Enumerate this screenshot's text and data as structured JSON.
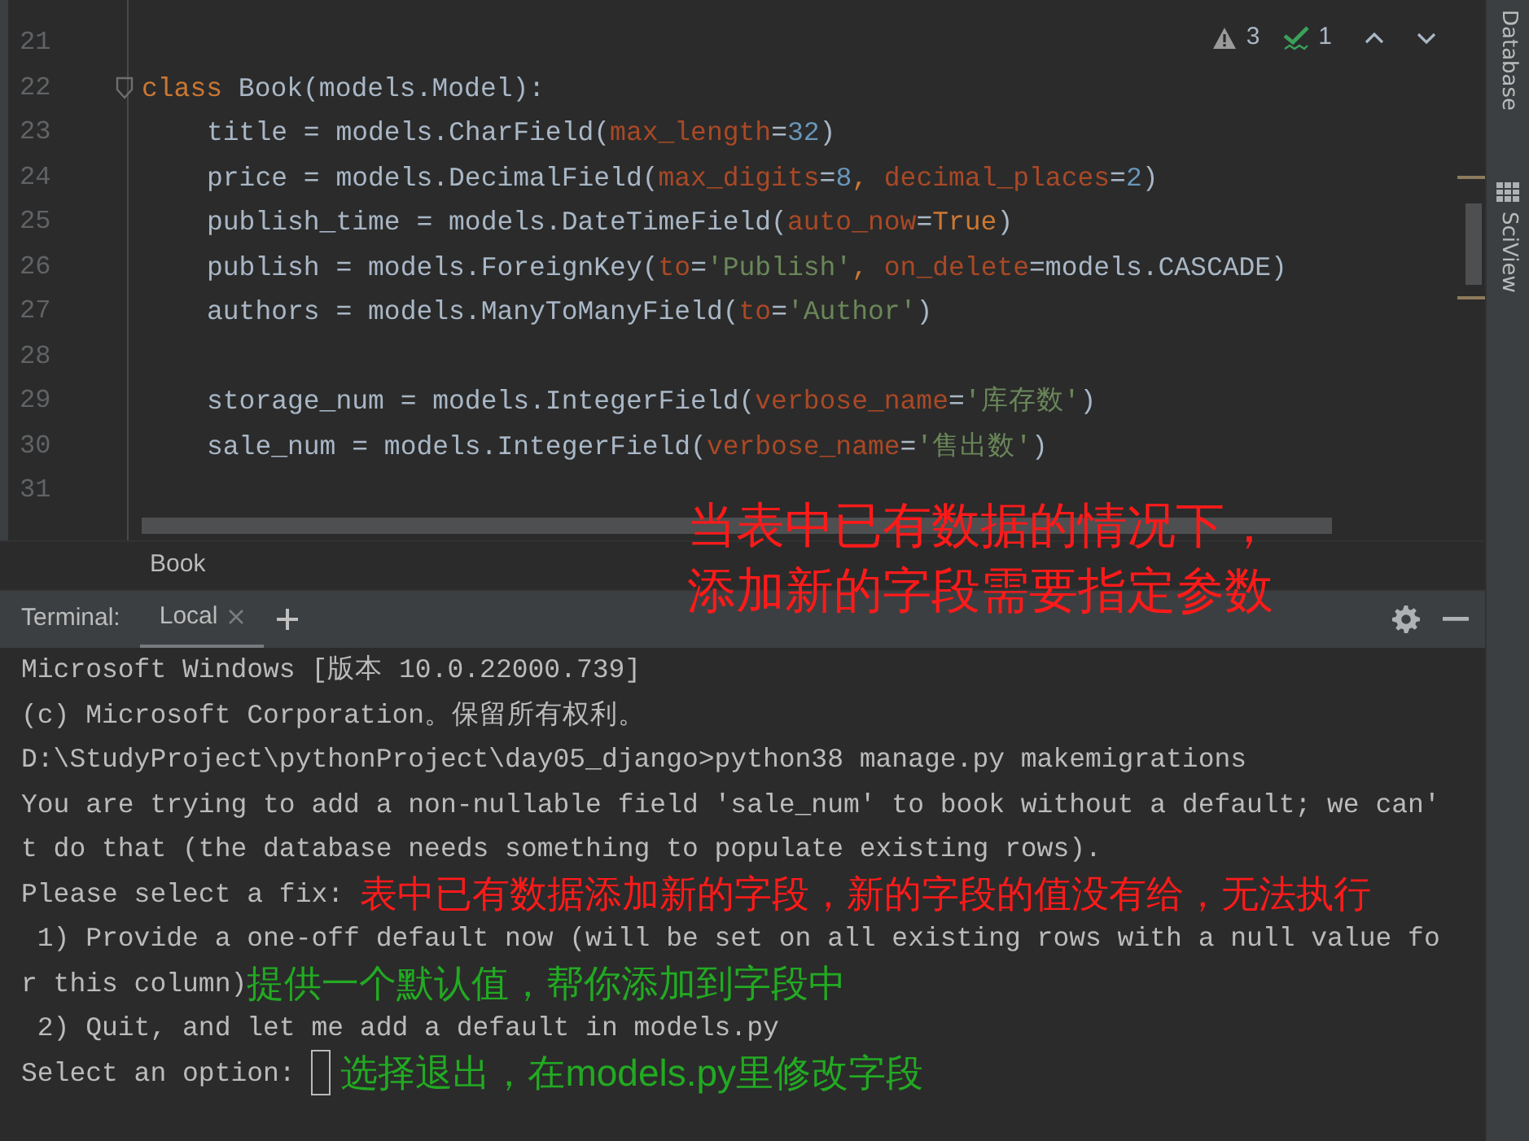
{
  "editor": {
    "inspections": {
      "warning_count": "3",
      "check_count": "1"
    },
    "lines": [
      {
        "number": "21"
      },
      {
        "number": "22",
        "foldable": true,
        "tokens": [
          {
            "kind": "keyword",
            "text": "class"
          },
          {
            "kind": "plain",
            "text": " Book(models.Model):"
          }
        ],
        "children": [
          {
            "number": "23",
            "tokens": [
              {
                "kind": "plain",
                "text": "title = models.CharField("
              },
              {
                "kind": "param",
                "text": "max_length"
              },
              {
                "kind": "plain",
                "text": "="
              },
              {
                "kind": "number",
                "text": "32"
              },
              {
                "kind": "plain",
                "text": ")"
              }
            ]
          },
          {
            "number": "24",
            "tokens": [
              {
                "kind": "plain",
                "text": "price = models.DecimalField("
              },
              {
                "kind": "param",
                "text": "max_digits"
              },
              {
                "kind": "plain",
                "text": "="
              },
              {
                "kind": "number",
                "text": "8"
              },
              {
                "kind": "keyword",
                "text": ", "
              },
              {
                "kind": "param",
                "text": "decimal_places"
              },
              {
                "kind": "plain",
                "text": "="
              },
              {
                "kind": "number",
                "text": "2"
              },
              {
                "kind": "plain",
                "text": ")"
              }
            ]
          },
          {
            "number": "25",
            "tokens": [
              {
                "kind": "plain",
                "text": "publish_time = models.DateTimeField("
              },
              {
                "kind": "param",
                "text": "auto_now"
              },
              {
                "kind": "plain",
                "text": "="
              },
              {
                "kind": "keyword",
                "text": "True"
              },
              {
                "kind": "plain",
                "text": ")"
              }
            ]
          },
          {
            "number": "26",
            "tokens": [
              {
                "kind": "plain",
                "text": "publish = models.ForeignKey("
              },
              {
                "kind": "param",
                "text": "to"
              },
              {
                "kind": "plain",
                "text": "="
              },
              {
                "kind": "string",
                "text": "'Publish'"
              },
              {
                "kind": "keyword",
                "text": ", "
              },
              {
                "kind": "param",
                "text": "on_delete"
              },
              {
                "kind": "plain",
                "text": "=models.CASCADE)"
              }
            ]
          },
          {
            "number": "27",
            "tokens": [
              {
                "kind": "plain",
                "text": "authors = models.ManyToManyField("
              },
              {
                "kind": "param",
                "text": "to"
              },
              {
                "kind": "plain",
                "text": "="
              },
              {
                "kind": "string",
                "text": "'Author'"
              },
              {
                "kind": "plain",
                "text": ")"
              }
            ]
          },
          {
            "number": "28"
          },
          {
            "number": "29",
            "tokens": [
              {
                "kind": "plain",
                "text": "storage_num = models.IntegerField("
              },
              {
                "kind": "param",
                "text": "verbose_name"
              },
              {
                "kind": "plain",
                "text": "="
              },
              {
                "kind": "string",
                "text": "'库存数'"
              },
              {
                "kind": "plain",
                "text": ")"
              }
            ]
          },
          {
            "number": "30",
            "tokens": [
              {
                "kind": "plain",
                "text": "sale_num = models.IntegerField("
              },
              {
                "kind": "param",
                "text": "verbose_name"
              },
              {
                "kind": "plain",
                "text": "="
              },
              {
                "kind": "string",
                "text": "'售出数'"
              },
              {
                "kind": "plain",
                "text": ")"
              }
            ]
          },
          {
            "number": "31"
          }
        ]
      }
    ]
  },
  "breadcrumb": "Book",
  "tool_strip": [
    {
      "kind": "text",
      "label": "Database"
    },
    {
      "kind": "icon-text",
      "label": "SciView"
    }
  ],
  "overlay_note": {
    "color": "#ff1a1a",
    "lines": [
      "当表中已有数据的情况下，",
      "添加新的字段需要指定参数"
    ]
  },
  "terminal": {
    "title": "Terminal:",
    "tabs": [
      {
        "label": "Local",
        "selected": true
      }
    ],
    "lines": [
      {
        "segments": [
          {
            "kind": "output",
            "text": "Microsoft Windows [版本 10.0.22000.739]"
          }
        ]
      },
      {
        "segments": [
          {
            "kind": "output",
            "text": "(c) Microsoft Corporation。保留所有权利。"
          }
        ]
      },
      {
        "segments": [
          {
            "kind": "output",
            "text": "D:\\StudyProject\\pythonProject\\day05_django>python38 manage.py makemigrations"
          }
        ]
      },
      {
        "segments": [
          {
            "kind": "output",
            "text": "You are trying to add a non-nullable field 'sale_num' to book without a default; we can'"
          }
        ]
      },
      {
        "segments": [
          {
            "kind": "output",
            "text": "t do that (the database needs something to populate existing rows)."
          }
        ]
      },
      {
        "segments": [
          {
            "kind": "output",
            "text": "Please select a fix: "
          },
          {
            "kind": "note",
            "color": "#ff1a1a",
            "text": "表中已有数据添加新的字段，新的字段的值没有给，无法执行"
          }
        ]
      },
      {
        "segments": [
          {
            "kind": "output",
            "text": " 1) Provide a one-off default now (will be set on all existing rows with a null value fo"
          }
        ]
      },
      {
        "segments": [
          {
            "kind": "output",
            "text": "r this column)"
          },
          {
            "kind": "note",
            "color": "#22aa22",
            "text": "提供一个默认值，帮你添加到字段中"
          }
        ]
      },
      {
        "segments": [
          {
            "kind": "output",
            "text": " 2) Quit, and let me add a default in models.py"
          }
        ]
      },
      {
        "segments": [
          {
            "kind": "output",
            "text": "Select an option: "
          },
          {
            "kind": "cursor"
          },
          {
            "kind": "note",
            "color": "#22aa22",
            "text": "选择退出，在models.py里修改字段"
          }
        ]
      }
    ]
  }
}
